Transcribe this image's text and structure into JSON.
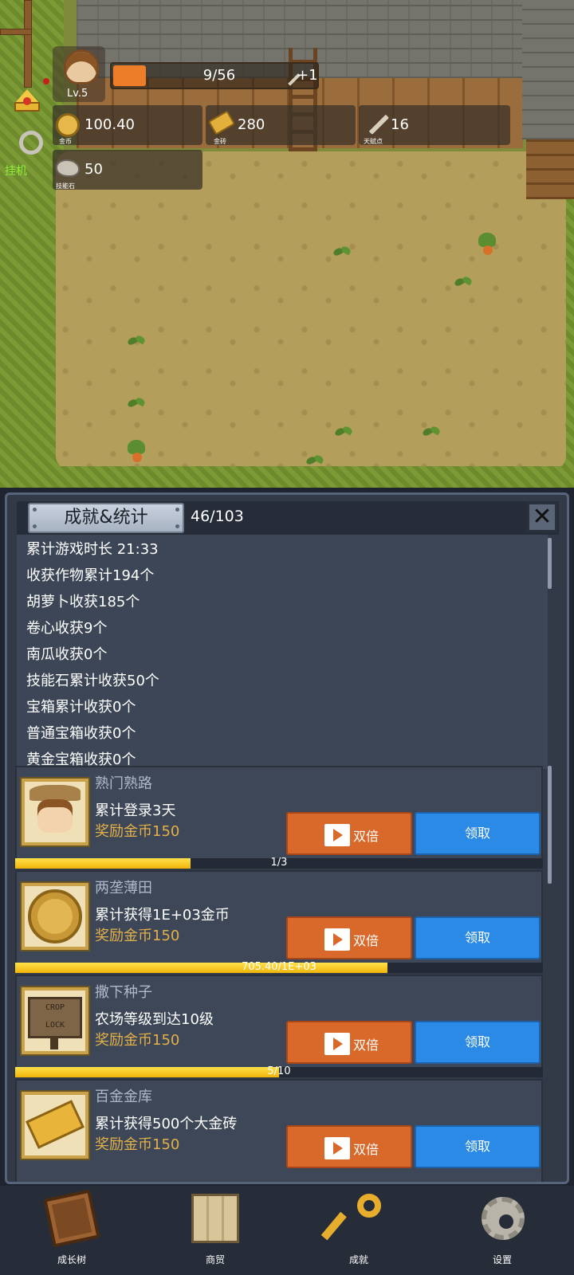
{
  "hud": {
    "level": "Lv.5",
    "exp": {
      "text": "9/56",
      "fraction": 0.16
    },
    "exp_bonus": "+1",
    "resources": [
      {
        "key": "gold_coin",
        "icon": "coin-icon",
        "value": "100.40",
        "caption": "金币"
      },
      {
        "key": "gold_brick",
        "icon": "gold-brick-icon",
        "value": "280",
        "caption": "金砖"
      },
      {
        "key": "talent",
        "icon": "talent-scroll-icon",
        "value": "16",
        "caption": "天赋点"
      },
      {
        "key": "skill_stone",
        "icon": "skill-stone-icon",
        "value": "50",
        "caption": "技能石"
      }
    ],
    "idle_label": "挂机"
  },
  "panel": {
    "title": "成就&统计",
    "progress": "46/103",
    "close_icon": "close-icon",
    "stats": [
      "累计游戏时长 21:33",
      "收获作物累计194个",
      "胡萝卜收获185个",
      "卷心收获9个",
      "南瓜收获0个",
      "技能石累计收获50个",
      "宝箱累计收获0个",
      "普通宝箱收获0个",
      "黄金宝箱收获0个"
    ],
    "achievements": [
      {
        "name": "熟门熟路",
        "desc": "累计登录3天",
        "reward": "奖励金币150",
        "double_label": "双倍",
        "claim_label": "领取",
        "progress_text": "1/3",
        "progress": 0.333
      },
      {
        "name": "两垄薄田",
        "desc": "累计获得1E+03金币",
        "reward": "奖励金币150",
        "double_label": "双倍",
        "claim_label": "领取",
        "progress_text": "705.40/1E+03",
        "progress": 0.7054
      },
      {
        "name": "撒下种子",
        "desc": "农场等级到达10级",
        "reward": "奖励金币150",
        "double_label": "双倍",
        "claim_label": "领取",
        "progress_text": "5/10",
        "progress": 0.5
      },
      {
        "name": "百金金库",
        "desc": "累计获得500个大金砖",
        "reward": "奖励金币150",
        "double_label": "双倍",
        "claim_label": "领取"
      }
    ],
    "sign_text": [
      "CROP",
      "LOCK"
    ]
  },
  "nav": [
    {
      "label": "成长树",
      "icon": "book-icon"
    },
    {
      "label": "商贸",
      "icon": "map-icon"
    },
    {
      "label": "成就",
      "icon": "key-icon"
    },
    {
      "label": "设置",
      "icon": "gear-icon"
    }
  ],
  "colors": {
    "panel_bg": "#323a47",
    "double_button": "#d9692a",
    "claim_button": "#2b8ae6",
    "reward_text": "#e4b148",
    "progress_fill": "#f0b40a",
    "exp_fill": "#ee7d2a",
    "idle_text": "#8cf03a"
  }
}
